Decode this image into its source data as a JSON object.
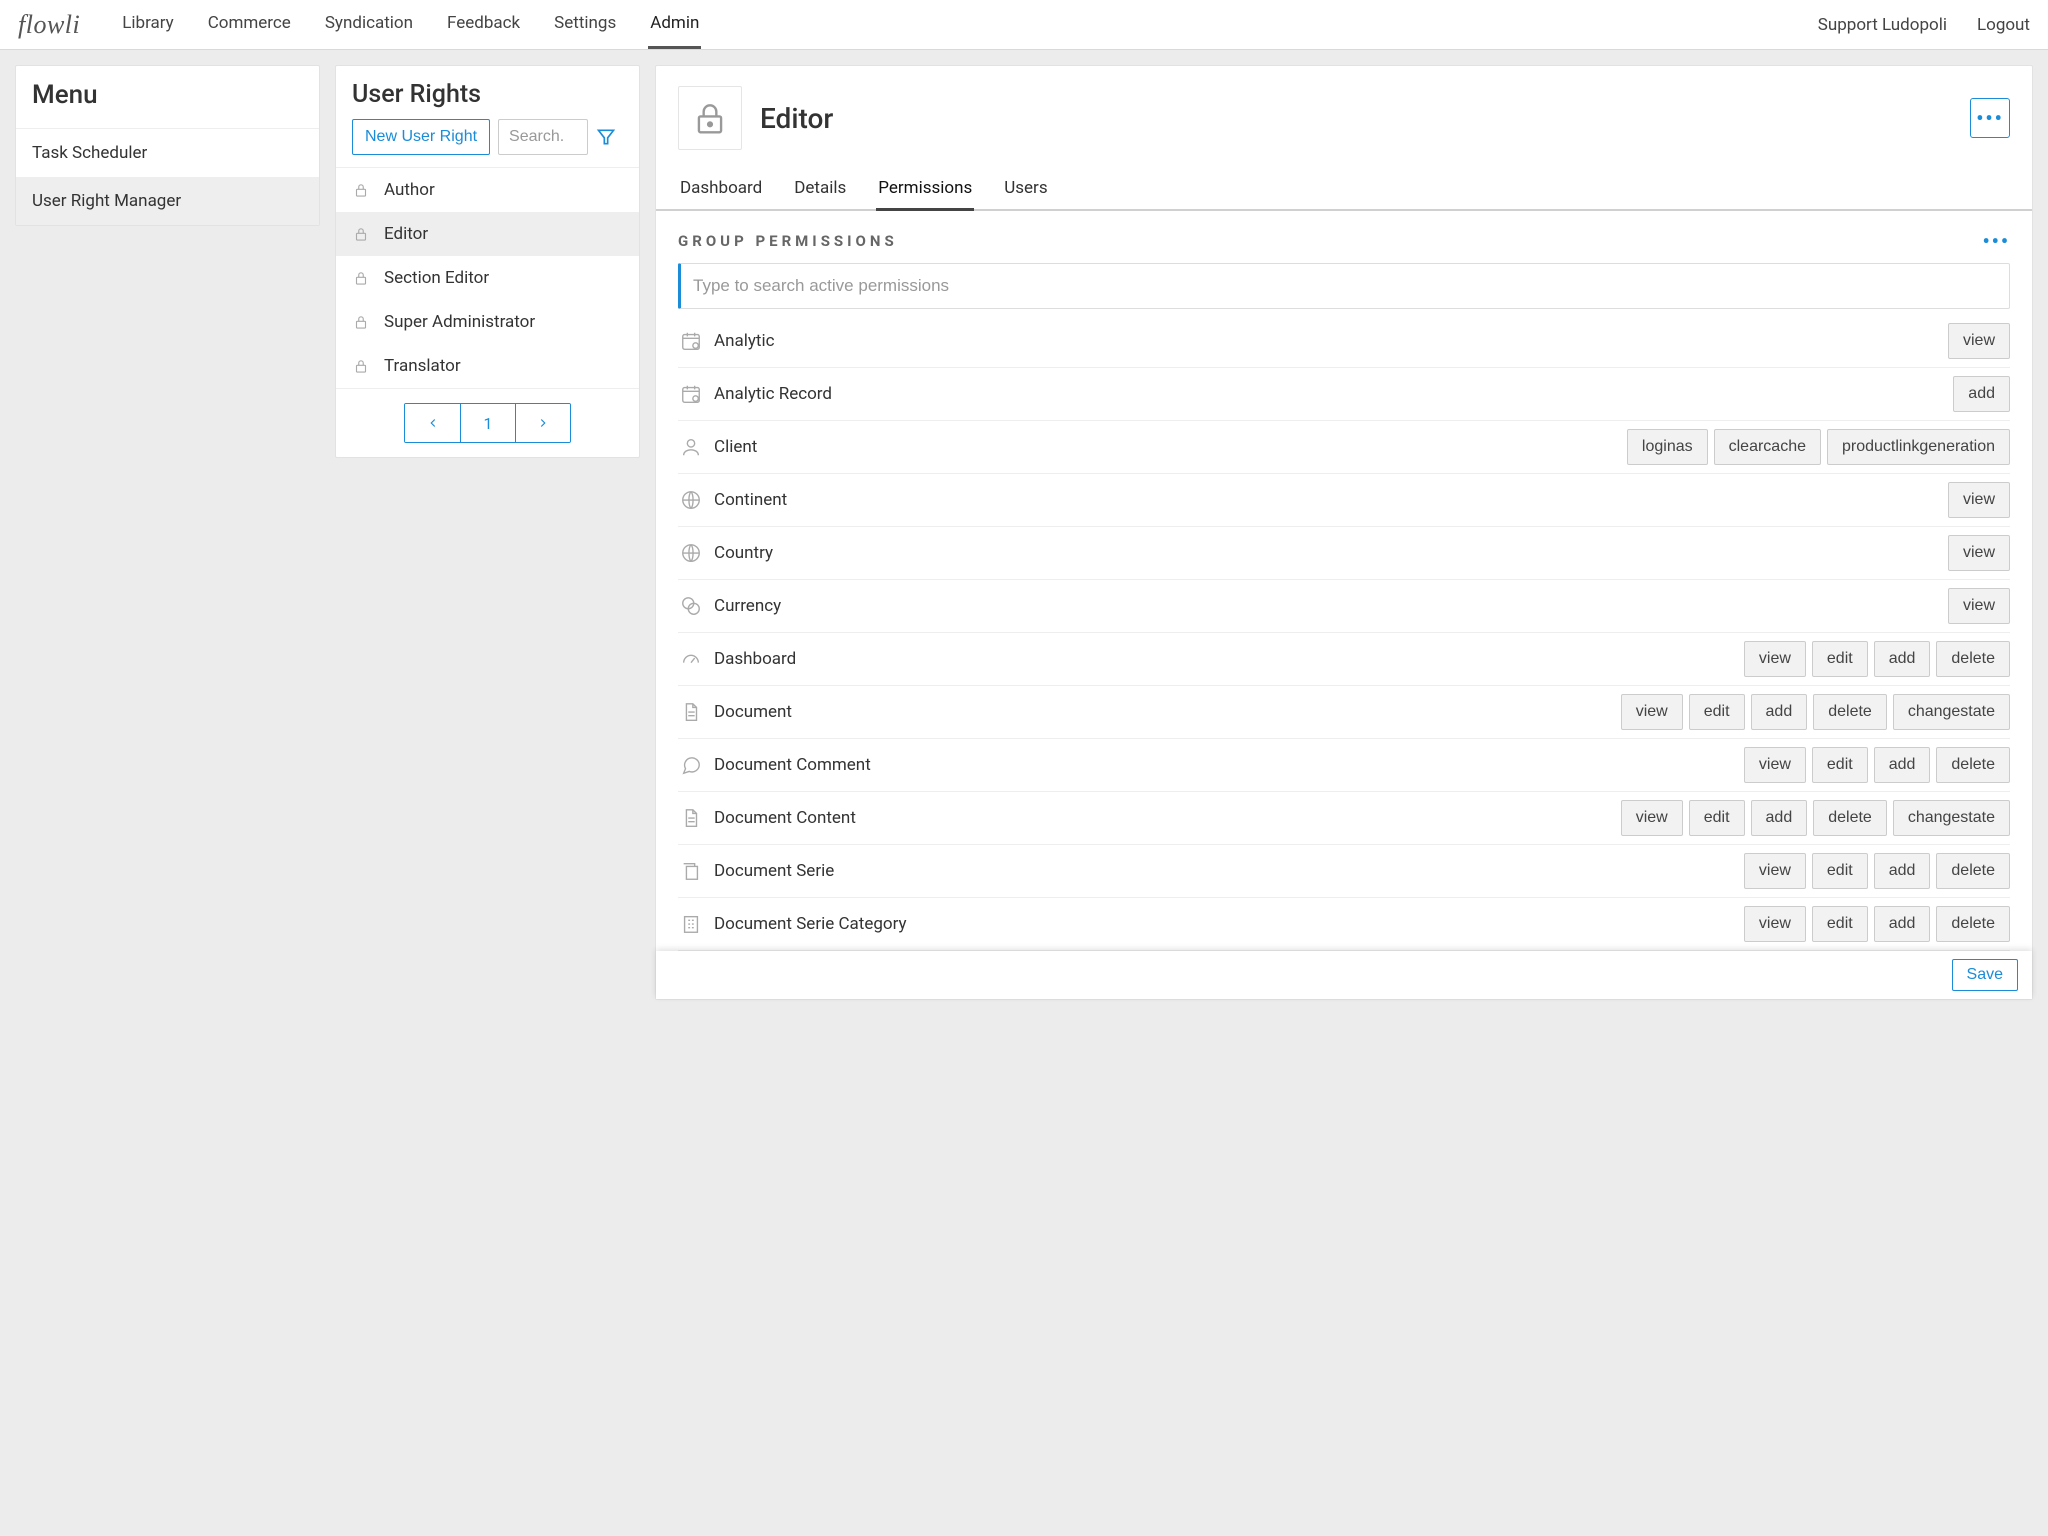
{
  "brand": "flowli",
  "nav": {
    "items": [
      "Library",
      "Commerce",
      "Syndication",
      "Feedback",
      "Settings",
      "Admin"
    ],
    "active_index": 5,
    "right": [
      "Support Ludopoli",
      "Logout"
    ]
  },
  "menu": {
    "title": "Menu",
    "items": [
      "Task Scheduler",
      "User Right Manager"
    ],
    "selected_index": 1
  },
  "rights": {
    "title": "User Rights",
    "new_button": "New User Right",
    "search_placeholder": "Search.",
    "items": [
      "Author",
      "Editor",
      "Section Editor",
      "Super Administrator",
      "Translator"
    ],
    "selected_index": 1,
    "page": "1"
  },
  "detail": {
    "title": "Editor",
    "tabs": [
      "Dashboard",
      "Details",
      "Permissions",
      "Users"
    ],
    "active_tab_index": 2,
    "section_title": "Group Permissions",
    "search_placeholder": "Type to search active permissions",
    "save_label": "Save",
    "permissions": [
      {
        "icon": "calendar",
        "label": "Analytic",
        "actions": [
          "view"
        ]
      },
      {
        "icon": "calendar",
        "label": "Analytic Record",
        "actions": [
          "add"
        ]
      },
      {
        "icon": "person",
        "label": "Client",
        "actions": [
          "loginas",
          "clearcache",
          "productlinkgeneration"
        ]
      },
      {
        "icon": "globe",
        "label": "Continent",
        "actions": [
          "view"
        ]
      },
      {
        "icon": "globe",
        "label": "Country",
        "actions": [
          "view"
        ]
      },
      {
        "icon": "currency",
        "label": "Currency",
        "actions": [
          "view"
        ]
      },
      {
        "icon": "gauge",
        "label": "Dashboard",
        "actions": [
          "view",
          "edit",
          "add",
          "delete"
        ]
      },
      {
        "icon": "doc",
        "label": "Document",
        "actions": [
          "view",
          "edit",
          "add",
          "delete",
          "changestate"
        ]
      },
      {
        "icon": "comment",
        "label": "Document Comment",
        "actions": [
          "view",
          "edit",
          "add",
          "delete"
        ]
      },
      {
        "icon": "doc",
        "label": "Document Content",
        "actions": [
          "view",
          "edit",
          "add",
          "delete",
          "changestate"
        ]
      },
      {
        "icon": "stack",
        "label": "Document Serie",
        "actions": [
          "view",
          "edit",
          "add",
          "delete"
        ]
      },
      {
        "icon": "building",
        "label": "Document Serie Category",
        "actions": [
          "view",
          "edit",
          "add",
          "delete"
        ]
      }
    ]
  }
}
